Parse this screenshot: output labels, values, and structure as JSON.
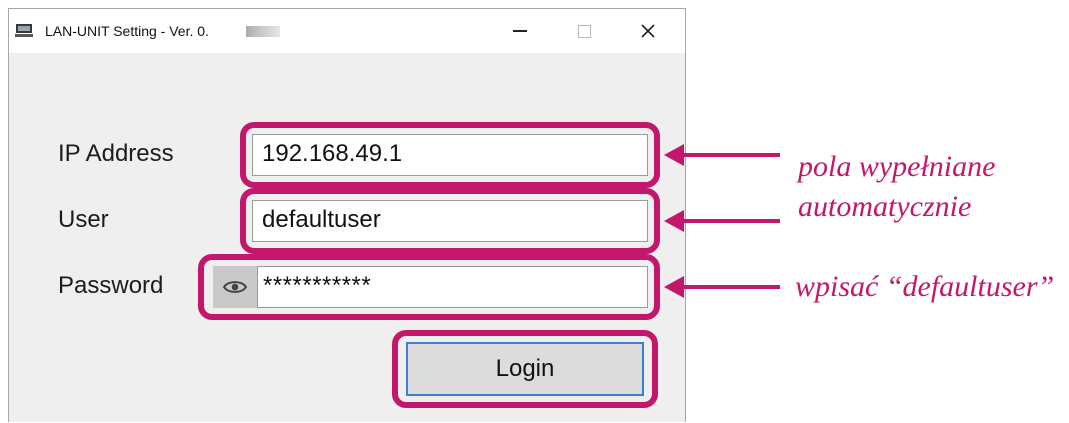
{
  "window": {
    "title": "LAN-UNIT Setting - Ver. 0.",
    "controls": {
      "minimize": "minimize",
      "maximize": "maximize",
      "close": "close"
    }
  },
  "form": {
    "ip_label": "IP Address",
    "ip_value": "192.168.49.1",
    "user_label": "User",
    "user_value": "defaultuser",
    "password_label": "Password",
    "password_value": "***********",
    "login_label": "Login"
  },
  "annotations": {
    "auto_filled_line1": "pola wypełniane",
    "auto_filled_line2": "automatycznie",
    "password_hint": "wpisać “defaultuser”"
  },
  "colors": {
    "highlight": "#c3176b",
    "focus_border": "#3f7fcf"
  },
  "icons": {
    "app": "computer-icon",
    "reveal_password": "eye-icon"
  }
}
